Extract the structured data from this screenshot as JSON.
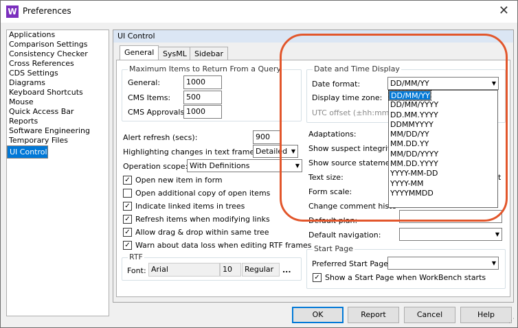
{
  "window": {
    "title": "Preferences",
    "app_icon": "W",
    "close_glyph": "✕"
  },
  "nav": {
    "items": [
      "Applications",
      "Comparison Settings",
      "Consistency Checker",
      "Cross References",
      "CDS Settings",
      "Diagrams",
      "Keyboard Shortcuts",
      "Mouse",
      "Quick Access Bar",
      "Reports",
      "Software Engineering",
      "Temporary Files",
      "UI Control"
    ],
    "selected": "UI Control"
  },
  "panel": {
    "header": "UI Control",
    "tabs": [
      "General",
      "SysML",
      "Sidebar"
    ]
  },
  "max_items": {
    "legend": "Maximum Items to Return From a Query",
    "general_label": "General:",
    "general_value": "1000",
    "cms_items_label": "CMS Items:",
    "cms_items_value": "500",
    "cms_approvals_label": "CMS Approvals:",
    "cms_approvals_value": "1000"
  },
  "alerts": {
    "alert_refresh_label": "Alert refresh (secs):",
    "alert_refresh_value": "900",
    "highlight_label": "Highlighting changes in text frames:",
    "highlight_value": "Detailed",
    "scope_label": "Operation scope:",
    "scope_value": "With Definitions"
  },
  "checkboxes": [
    {
      "label": "Open new item in form",
      "checked": true
    },
    {
      "label": "Open additional copy of open items",
      "checked": false
    },
    {
      "label": "Indicate linked items in trees",
      "checked": true
    },
    {
      "label": "Refresh items when modifying links",
      "checked": true
    },
    {
      "label": "Allow drag & drop within same tree",
      "checked": true
    },
    {
      "label": "Warn about data loss when editing RTF frames",
      "checked": true
    }
  ],
  "rtf": {
    "legend": "RTF",
    "font_label": "Font:",
    "font_value": "Arial",
    "size_value": "10",
    "style_value": "Regular",
    "more": "..."
  },
  "datetime": {
    "legend": "Date and Time Display",
    "date_format_label": "Date format:",
    "date_format_value": "DD/MM/YY",
    "time_zone_label": "Display time zone:",
    "utc_label": "UTC offset (±hh:mm):"
  },
  "date_format_options": [
    "DD/MM/YY",
    "DD.MM.YY",
    "DD/MM/YYYY",
    "DD.MM.YYYY",
    "DDMMYYYY",
    "MM/DD/YY",
    "MM.DD.YY",
    "MM/DD/YYYY",
    "MM.DD.YYYY",
    "YYYY-MM-DD",
    "YYYY-MM",
    "YYYYMMDD"
  ],
  "right_options": {
    "adaptations": "Adaptations:",
    "suspect": "Show suspect integrity",
    "source_stmt": "Show source statemen",
    "text_size": "Text size:",
    "text_size_tail": "t",
    "form_scale": "Form scale:",
    "comment_history": "Change comment histo",
    "default_plan": "Default plan:",
    "default_navigation": "Default navigation:"
  },
  "start_page": {
    "legend": "Start Page",
    "preferred_label": "Preferred Start Page:",
    "show_label": "Show a Start Page when WorkBench starts",
    "checked": true
  },
  "buttons": {
    "ok": "OK",
    "report": "Report",
    "cancel": "Cancel",
    "help": "Help"
  },
  "colors": {
    "selection": "#0078d7",
    "highlight_oval": "#e2562b",
    "app_icon": "#7b2fbe"
  }
}
